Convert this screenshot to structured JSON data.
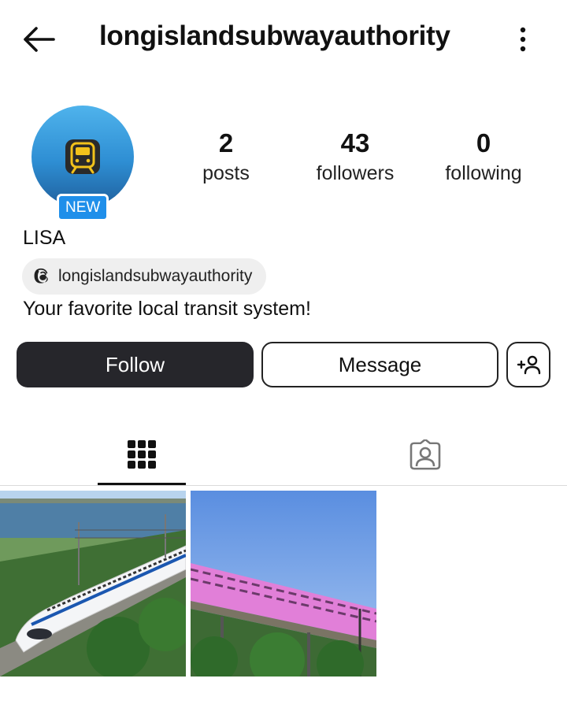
{
  "header": {
    "username": "longislandsubwayauthority",
    "back_icon": "arrow-left-icon",
    "menu_icon": "more-vertical-icon"
  },
  "profile": {
    "avatar_badge": "NEW",
    "display_name": "LISA",
    "threads_handle": "longislandsubwayauthority",
    "bio": "Your favorite local transit system!"
  },
  "stats": [
    {
      "value": "2",
      "label": "posts"
    },
    {
      "value": "43",
      "label": "followers"
    },
    {
      "value": "0",
      "label": "following"
    }
  ],
  "actions": {
    "follow_label": "Follow",
    "message_label": "Message",
    "add_user_icon": "add-person-icon"
  },
  "tabs": [
    {
      "icon": "grid-icon",
      "selected": true
    },
    {
      "icon": "tagged-person-icon",
      "selected": false
    }
  ],
  "colors": {
    "follow_bg": "#26262b",
    "badge_blue": "#1f8fea",
    "threads_pill": "#efefef"
  }
}
